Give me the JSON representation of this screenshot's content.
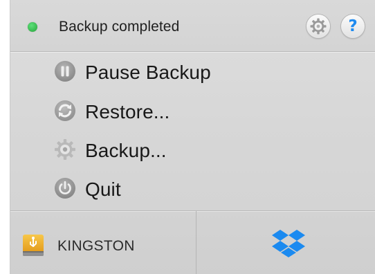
{
  "header": {
    "status_text": "Backup completed",
    "status_color": "#2fb34a",
    "buttons": [
      {
        "icon": "gear-icon"
      },
      {
        "icon": "help-icon",
        "glyph": "?"
      }
    ]
  },
  "menu": {
    "items": [
      {
        "label": "Pause Backup",
        "icon": "pause-icon"
      },
      {
        "label": "Restore...",
        "icon": "restore-icon"
      },
      {
        "label": "Backup...",
        "icon": "gear-icon"
      },
      {
        "label": "Quit",
        "icon": "power-icon"
      }
    ]
  },
  "footer": {
    "drive": {
      "label": "KINGSTON",
      "icon": "usb-drive-icon"
    },
    "service": {
      "icon": "dropbox-icon",
      "color": "#1b8af0"
    }
  }
}
